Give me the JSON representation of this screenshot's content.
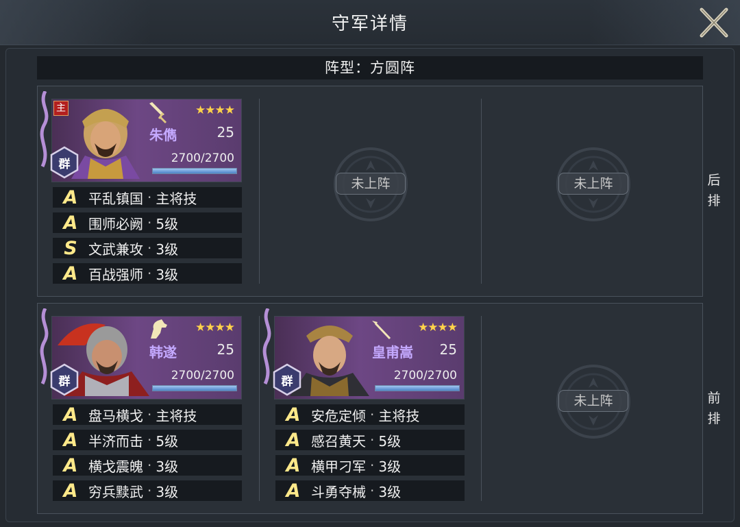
{
  "title": "守军详情",
  "formation_text": "阵型：方圆阵",
  "row_labels": {
    "back": "后\n排",
    "front": "前\n排"
  },
  "back_label_1": "后",
  "back_label_2": "排",
  "front_label_1": "前",
  "front_label_2": "排",
  "empty_slot_label": "未上阵",
  "lord_badge": "主",
  "heroes": [
    {
      "name": "朱儁",
      "level": "25",
      "hp": "2700/2700",
      "hp_fraction": 1.0,
      "stars": "★★★★",
      "faction": "群",
      "is_lord": true,
      "weapon_icon": "sword-icon",
      "skills": [
        {
          "grade": "A",
          "name": "平乱镇国",
          "level": "主将技"
        },
        {
          "grade": "A",
          "name": "围师必阙",
          "level": "5级"
        },
        {
          "grade": "S",
          "name": "文武兼攻",
          "level": "3级"
        },
        {
          "grade": "A",
          "name": "百战强师",
          "level": "3级"
        }
      ]
    },
    {
      "name": "韩遂",
      "level": "25",
      "hp": "2700/2700",
      "hp_fraction": 1.0,
      "stars": "★★★★",
      "faction": "群",
      "is_lord": false,
      "weapon_icon": "horse-icon",
      "skills": [
        {
          "grade": "A",
          "name": "盘马横戈",
          "level": "主将技"
        },
        {
          "grade": "A",
          "name": "半济而击",
          "level": "5级"
        },
        {
          "grade": "A",
          "name": "横戈震魄",
          "level": "3级"
        },
        {
          "grade": "A",
          "name": "穷兵黩武",
          "level": "3级"
        }
      ]
    },
    {
      "name": "皇甫嵩",
      "level": "25",
      "hp": "2700/2700",
      "hp_fraction": 1.0,
      "stars": "★★★★",
      "faction": "群",
      "is_lord": false,
      "weapon_icon": "spear-icon",
      "skills": [
        {
          "grade": "A",
          "name": "安危定倾",
          "level": "主将技"
        },
        {
          "grade": "A",
          "name": "感召黄天",
          "level": "5级"
        },
        {
          "grade": "A",
          "name": "横甲刁军",
          "level": "3级"
        },
        {
          "grade": "A",
          "name": "斗勇夺械",
          "level": "3级"
        }
      ]
    }
  ],
  "sep": "·"
}
